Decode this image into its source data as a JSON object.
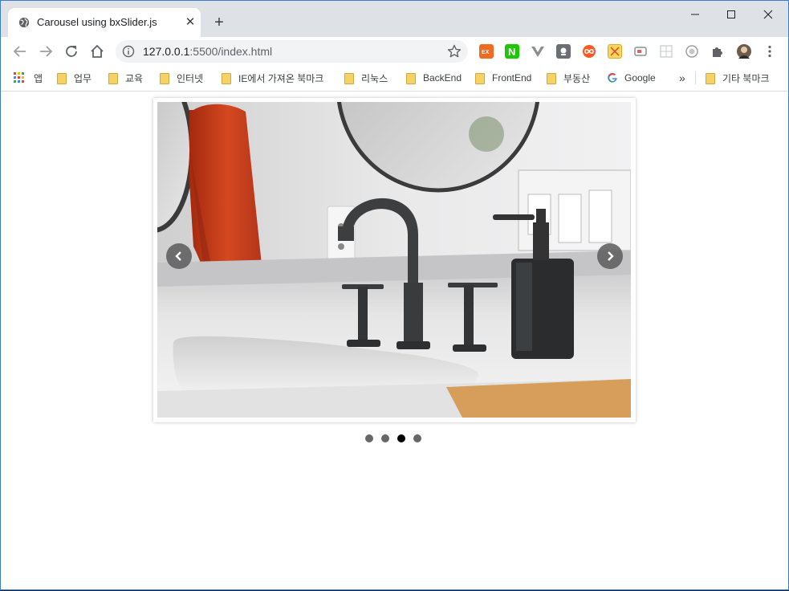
{
  "tab": {
    "title": "Carousel using bxSlider.js",
    "favicon": "globe-icon"
  },
  "address_bar": {
    "host": "127.0.0.1",
    "rest": ":5500/index.html"
  },
  "bookmarks": {
    "apps": "앱",
    "items": [
      "업무",
      "교육",
      "인터넷",
      "IE에서 가져온 북마크",
      "리눅스",
      "BackEnd",
      "FrontEnd",
      "부동산"
    ],
    "google": "Google",
    "overflow": "»",
    "other": "기타 북마크"
  },
  "slider": {
    "slide_count": 4,
    "active_index": 2,
    "current_image": "bathroom-sink-photo"
  },
  "colors": {
    "titlebar": "#dee1e6",
    "accent": "#3a7ec9",
    "dot": "#666666",
    "dot_active": "#000000"
  }
}
